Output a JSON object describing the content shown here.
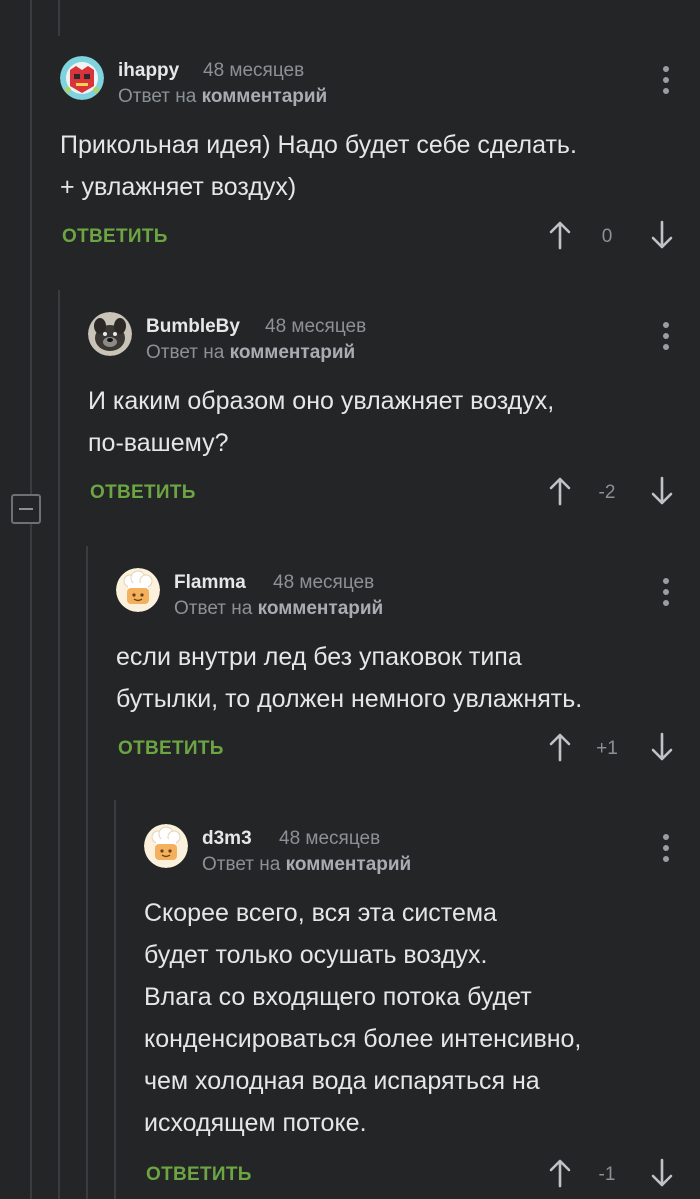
{
  "comments": [
    {
      "username": "ihappy",
      "time": "48 месяцев",
      "reply_prefix": "Ответ на",
      "reply_link": "комментарий",
      "text": "Прикольная идея) Надо будет себе сделать.\n+ увлажняет воздух)",
      "reply_label": "ОТВЕТИТЬ",
      "votes": "0",
      "avatar": "red-skull-avatar"
    },
    {
      "username": "BumbleBy",
      "time": "48 месяцев",
      "reply_prefix": "Ответ на",
      "reply_link": "комментарий",
      "text": "И каким образом оно увлажняет воздух,\nпо-вашему?",
      "reply_label": "ОТВЕТИТЬ",
      "votes": "-2",
      "avatar": "dog-photo-avatar"
    },
    {
      "username": "Flamma",
      "time": "48 месяцев",
      "reply_prefix": "Ответ на",
      "reply_link": "комментарий",
      "text": "если внутри лед без упаковок типа\nбутылки, то должен немного увлажнять.",
      "reply_label": "ОТВЕТИТЬ",
      "votes": "+1",
      "avatar": "default-chef-avatar"
    },
    {
      "username": "d3m3",
      "time": "48 месяцев",
      "reply_prefix": "Ответ на",
      "reply_link": "комментарий",
      "text": "Скорее всего, вся эта система\nбудет только осушать воздух.\nВлага со входящего потока будет\nконденсироваться более интенсивно,\nчем холодная вода испаряться на\nисходящем потоке.",
      "reply_label": "ОТВЕТИТЬ",
      "votes": "-1",
      "avatar": "default-chef-avatar"
    }
  ],
  "colors": {
    "background": "#232527",
    "reply_green": "#6da542",
    "muted_text": "#8c9195",
    "thread_line": "#3a3d40"
  },
  "icons": {
    "upvote": "arrow-up-icon",
    "downvote": "arrow-down-icon",
    "menu": "more-vertical-icon",
    "collapse": "minus-square-icon"
  }
}
